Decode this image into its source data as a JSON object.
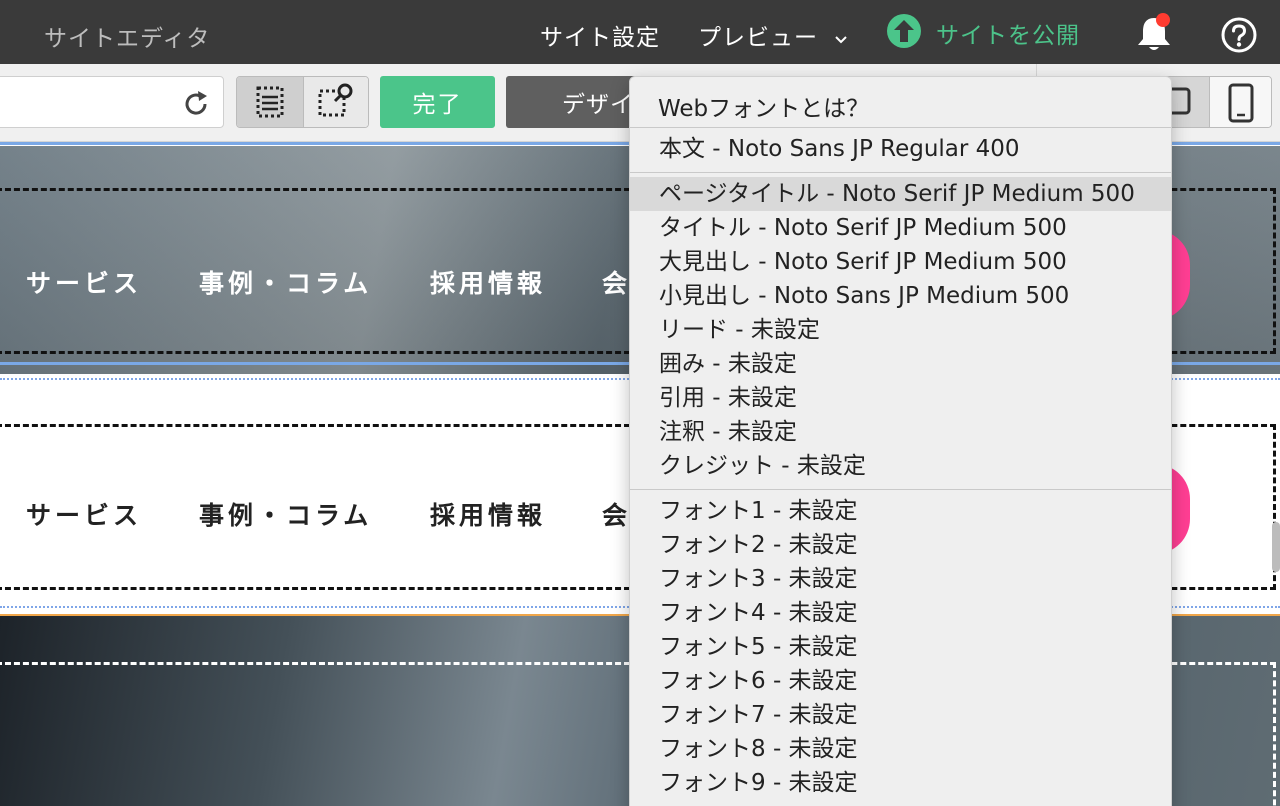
{
  "topbar": {
    "app_title": "サイトエディタ",
    "site_settings": "サイト設定",
    "preview": "プレビュー",
    "publish": "サイトを公開",
    "icons": [
      "chevron-down-icon",
      "upload-icon",
      "bell-icon",
      "help-icon"
    ],
    "accent_color": "#4bc58a",
    "notification_dot_color": "#ff3b30"
  },
  "toolbar": {
    "done_label": "完了",
    "design_label": "デザイ",
    "icons": [
      "reload-icon",
      "select-frame-icon",
      "select-search-icon",
      "tablet-icon",
      "phone-icon"
    ]
  },
  "canvas": {
    "header_nav_dark_bg": [
      "サービス",
      "事例・コラム",
      "採用情報",
      "会"
    ],
    "header_nav_light_bg": [
      "サービス",
      "事例・コラム",
      "採用情報",
      "会"
    ],
    "cta_color": "#ff3e93"
  },
  "font_menu": {
    "header": "Webフォントとは？",
    "body_font": "本文 - Noto Sans JP Regular 400",
    "style_items": [
      "ページタイトル - Noto Serif JP Medium 500",
      "タイトル - Noto Serif JP Medium 500",
      "大見出し - Noto Serif JP Medium 500",
      "小見出し - Noto Sans JP Medium 500",
      "リード - 未設定",
      "囲み - 未設定",
      "引用 - 未設定",
      "注釈 - 未設定",
      "クレジット - 未設定"
    ],
    "custom_fonts": [
      "フォント1 - 未設定",
      "フォント2 - 未設定",
      "フォント3 - 未設定",
      "フォント4 - 未設定",
      "フォント5 - 未設定",
      "フォント6 - 未設定",
      "フォント7 - 未設定",
      "フォント8 - 未設定",
      "フォント9 - 未設定"
    ],
    "highlighted_item": "ページタイトル - Noto Serif JP Medium 500"
  }
}
